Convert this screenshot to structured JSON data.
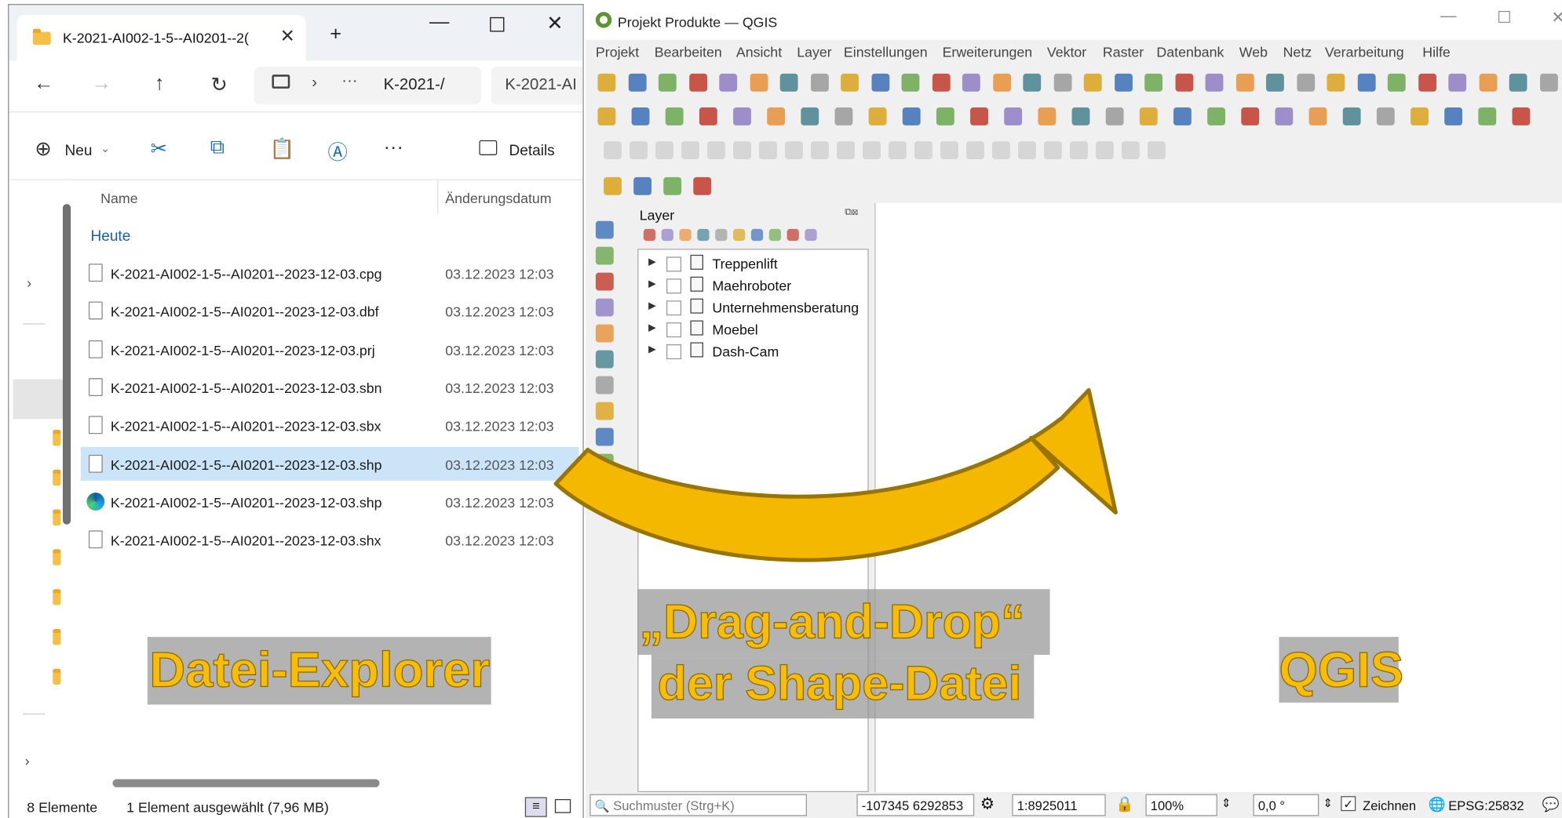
{
  "explorer": {
    "tab_title": "K-2021-AI002-1-5--AI0201--2(",
    "address": "K-2021-/",
    "search": "K-2021-AI",
    "new_label": "Neu",
    "details_label": "Details",
    "col_name": "Name",
    "col_date": "Änderungsdatum",
    "group_label": "Heute",
    "files": [
      {
        "name": "K-2021-AI002-1-5--AI0201--2023-12-03.cpg",
        "date": "03.12.2023 12:03",
        "icon": "file-icon"
      },
      {
        "name": "K-2021-AI002-1-5--AI0201--2023-12-03.dbf",
        "date": "03.12.2023 12:03",
        "icon": "file-icon"
      },
      {
        "name": "K-2021-AI002-1-5--AI0201--2023-12-03.prj",
        "date": "03.12.2023 12:03",
        "icon": "file-icon"
      },
      {
        "name": "K-2021-AI002-1-5--AI0201--2023-12-03.sbn",
        "date": "03.12.2023 12:03",
        "icon": "file-icon"
      },
      {
        "name": "K-2021-AI002-1-5--AI0201--2023-12-03.sbx",
        "date": "03.12.2023 12:03",
        "icon": "file-icon"
      },
      {
        "name": "K-2021-AI002-1-5--AI0201--2023-12-03.shp",
        "date": "03.12.2023 12:03",
        "icon": "file-icon",
        "selected": true
      },
      {
        "name": "K-2021-AI002-1-5--AI0201--2023-12-03.shp",
        "date": "03.12.2023 12:03",
        "icon": "edge-icon"
      },
      {
        "name": "K-2021-AI002-1-5--AI0201--2023-12-03.shx",
        "date": "03.12.2023 12:03",
        "icon": "file-icon"
      }
    ],
    "status_count": "8 Elemente",
    "status_selected": "1 Element ausgewählt (7,96 MB)"
  },
  "qgis": {
    "title": "Projekt Produkte — QGIS",
    "menu": [
      "Projekt",
      "Bearbeiten",
      "Ansicht",
      "Layer",
      "Einstellungen",
      "Erweiterungen",
      "Vektor",
      "Raster",
      "Datenbank",
      "Web",
      "Netz",
      "Verarbeitung",
      "Hilfe"
    ],
    "layer_panel_title": "Layer",
    "layers": [
      "Treppenlift",
      "Maehroboter",
      "Unternehmensberatung",
      "Moebel",
      "Dash-Cam"
    ],
    "search_placeholder": "Suchmuster (Strg+K)",
    "coordinate": "-107345 6292853",
    "scale": "1:8925011",
    "magnifier": "100%",
    "rotation": "0,0 °",
    "render_label": "Zeichnen",
    "crs": "EPSG:25832"
  },
  "overlays": {
    "explorer_label": "Datei-Explorer",
    "drag_line1": "„Drag-and-Drop“",
    "drag_line2": "der Shape-Datei",
    "qgis_label": "QGIS"
  },
  "colors": {
    "accent": "#f7bd0a",
    "selection": "#cce4f7",
    "arrow": "#f5b800"
  }
}
